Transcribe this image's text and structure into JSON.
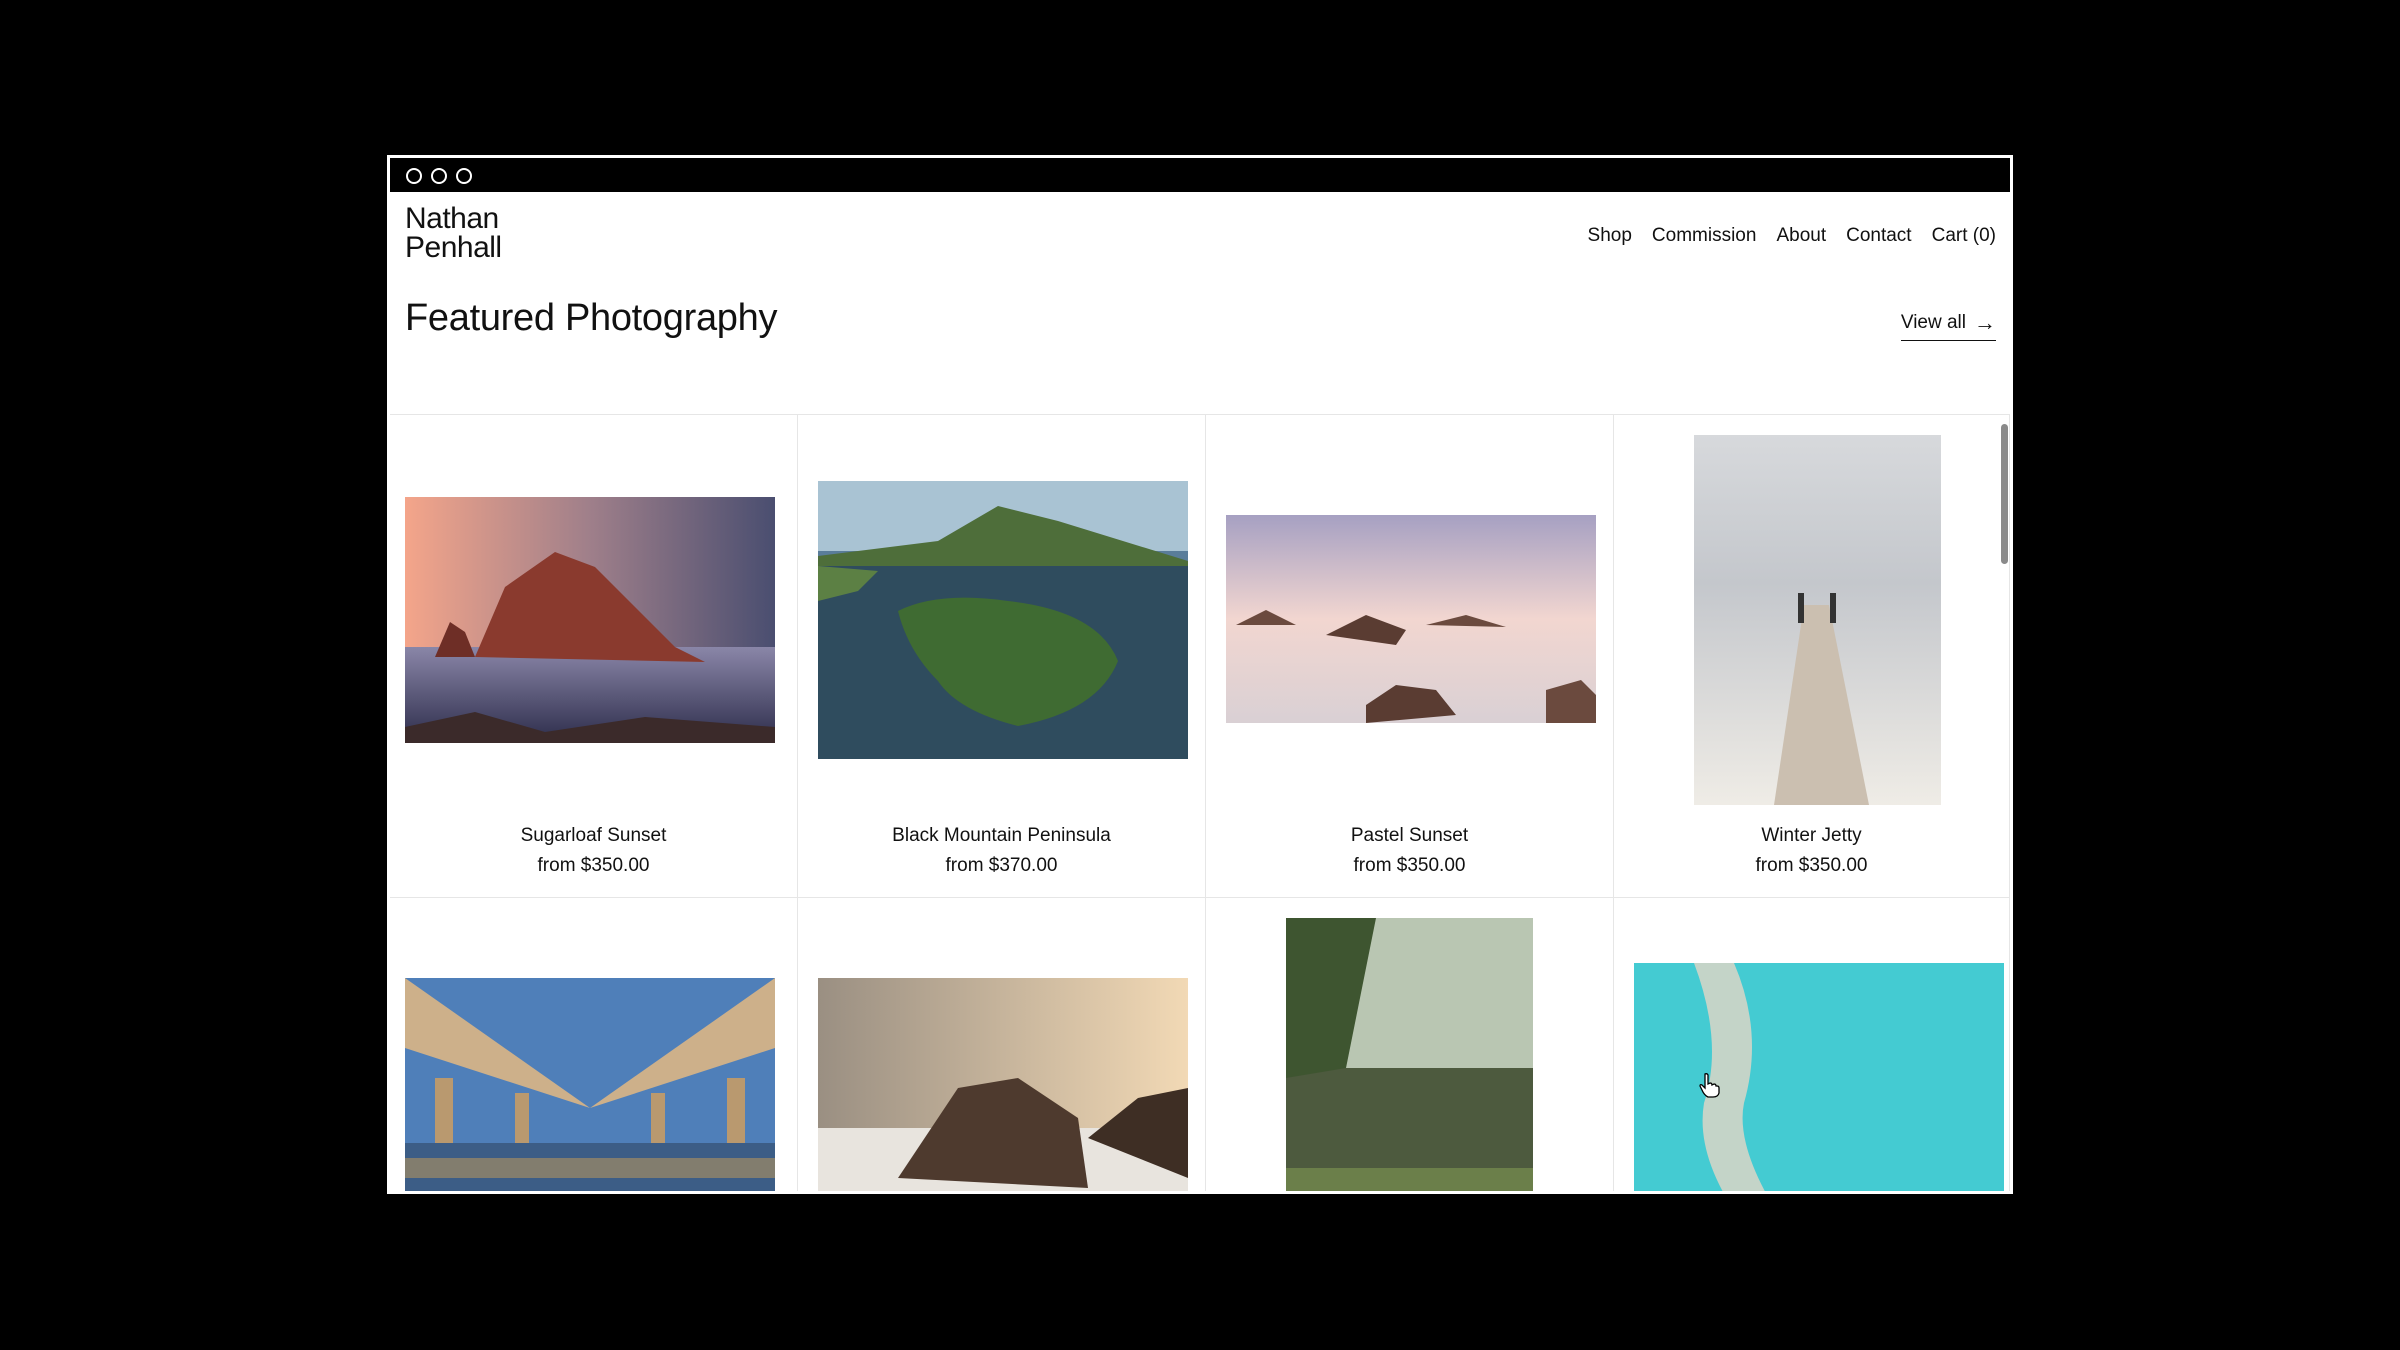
{
  "site": {
    "logo_line1": "Nathan",
    "logo_line2": "Penhall"
  },
  "nav": {
    "shop": "Shop",
    "commission": "Commission",
    "about": "About",
    "contact": "Contact",
    "cart": "Cart (0)"
  },
  "section": {
    "title": "Featured Photography",
    "view_all": "View all",
    "view_all_arrow": "→"
  },
  "products": [
    {
      "title": "Sugarloaf Sunset",
      "price": "from $350.00"
    },
    {
      "title": "Black Mountain Peninsula",
      "price": "from $370.00"
    },
    {
      "title": "Pastel Sunset",
      "price": "from $350.00"
    },
    {
      "title": "Winter Jetty",
      "price": "from $350.00"
    },
    {
      "title": "",
      "price": ""
    },
    {
      "title": "",
      "price": ""
    },
    {
      "title": "",
      "price": ""
    },
    {
      "title": "",
      "price": ""
    }
  ],
  "colors": {
    "window_frame": "#000000",
    "background": "#ffffff",
    "text": "#111111",
    "divider": "#e6e6e6"
  }
}
